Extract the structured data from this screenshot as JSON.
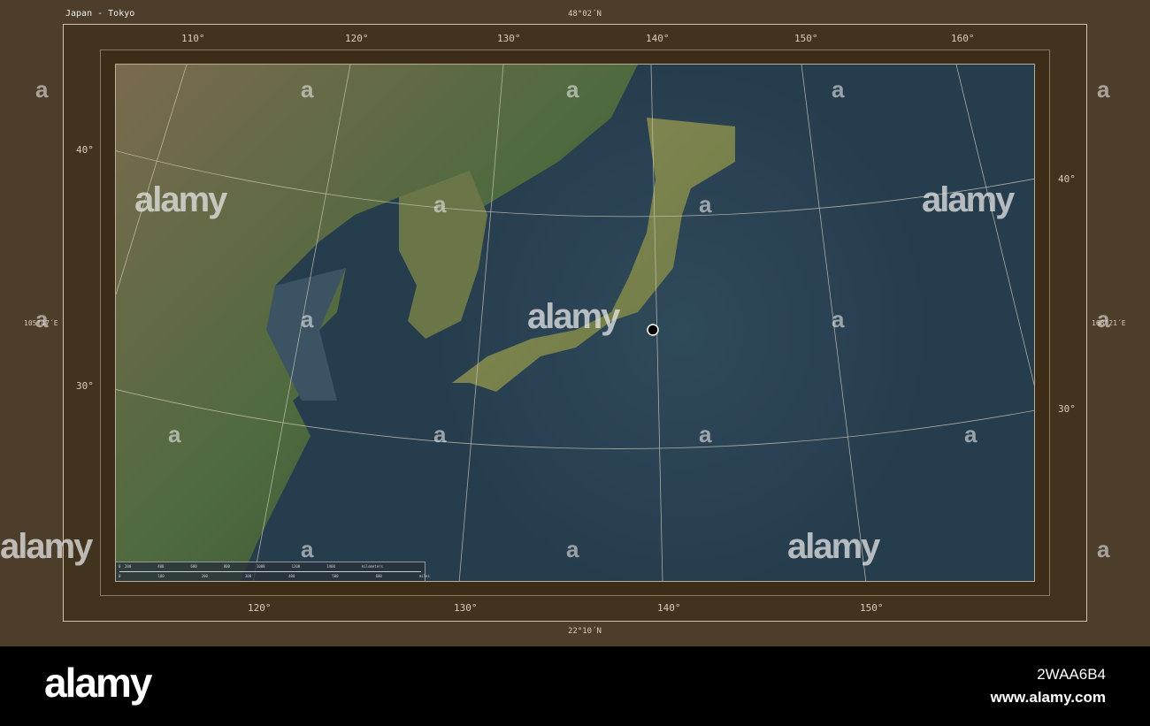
{
  "title": "Japan - Tokyo",
  "top_lat": "48°02´N",
  "bottom_lat": "22°10´N",
  "left_lon": "105°47´E",
  "right_lon": "168°21´E",
  "top_lon_ticks": [
    "110°",
    "120°",
    "130°",
    "140°",
    "150°",
    "160°"
  ],
  "bottom_lon_ticks": [
    "120°",
    "130°",
    "140°",
    "150°"
  ],
  "left_lat_ticks": [
    "40°",
    "30°"
  ],
  "right_lat_ticks": [
    "40°",
    "30°"
  ],
  "scale_bar": {
    "km_ticks": [
      "0",
      "200",
      "400",
      "600",
      "800",
      "1000",
      "1200",
      "1400"
    ],
    "km_label": "kilometers",
    "mi_ticks": [
      "0",
      "100",
      "200",
      "300",
      "400",
      "500",
      "600"
    ],
    "mi_label": "miles"
  },
  "marker": {
    "city": "Tokyo",
    "color": "#000000"
  },
  "watermark": "alamy",
  "watermark_letter": "a",
  "banner": {
    "logo": "alamy",
    "image_id": "2WAA6B4",
    "url": "www.alamy.com"
  }
}
